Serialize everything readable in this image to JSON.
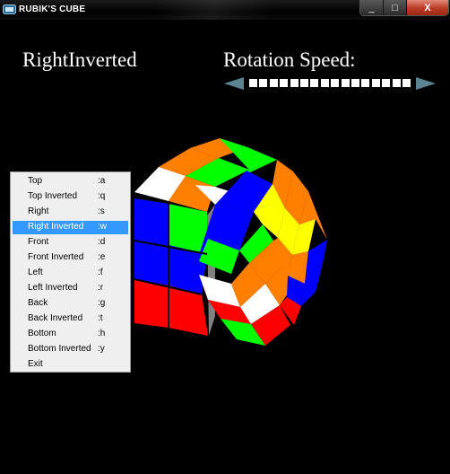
{
  "window": {
    "title": "RUBIK'S CUBE",
    "controls": {
      "minimize": "_",
      "maximize": "□",
      "close": "X"
    }
  },
  "mode_label": "RightInverted",
  "rotation_speed": {
    "label": "Rotation Speed:",
    "segments": 16,
    "filled": 16
  },
  "menu": {
    "selected_index": 3,
    "items": [
      {
        "label": "Top",
        "key": ":a"
      },
      {
        "label": "Top Inverted",
        "key": ":q"
      },
      {
        "label": "Right",
        "key": ":s"
      },
      {
        "label": "Right Inverted",
        "key": ":w"
      },
      {
        "label": "Front",
        "key": ":d"
      },
      {
        "label": "Front Inverted",
        "key": ":e"
      },
      {
        "label": "Left",
        "key": ":f"
      },
      {
        "label": "Left Inverted",
        "key": ":r"
      },
      {
        "label": "Back",
        "key": ":g"
      },
      {
        "label": "Back Inverted",
        "key": ":t"
      },
      {
        "label": "Bottom",
        "key": ":h"
      },
      {
        "label": "Bottom Inverted",
        "key": ":y"
      },
      {
        "label": "Exit",
        "key": ""
      }
    ]
  },
  "colors": {
    "red": "#ff0000",
    "green": "#00ff00",
    "blue": "#0000ff",
    "orange": "#ff7f00",
    "yellow": "#ffff00",
    "white": "#ffffff",
    "gray": "#808080"
  }
}
